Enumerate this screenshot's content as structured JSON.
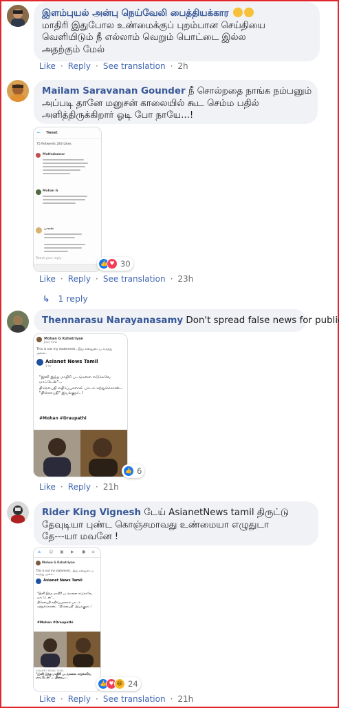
{
  "colors": {
    "link": "#385898",
    "action": "#4267b2",
    "bubble": "#f0f2f5",
    "frame": "#e0262b"
  },
  "comments": [
    {
      "author": "இளம்புயல் அன்பு நெய்வேலி பைத்தியக்கார",
      "text_lines": [
        "மாதிரி இதுபோல உண்மைக்குப் புறம்பான செய்தியை",
        "வெளியிடும் நீ எல்லாம் வெறும் பொட்டை இல்ல",
        "அதற்கும் மேல்"
      ],
      "like": "Like",
      "reply": "Reply",
      "translate": "See translation",
      "time": "2h"
    },
    {
      "author": "Mailam Saravanan Gounder",
      "text_first": "நீ சொல்றதை நாங்க நம்பனும்",
      "text_lines": [
        "அப்படி தானே மனுசன் காலையில் கூட செம்ம பதில்",
        "அளித்திருக்கிறார் ஓடி போ நாயே...!"
      ],
      "reactions": "30",
      "like": "Like",
      "reply": "Reply",
      "translate": "See translation",
      "time": "23h",
      "replies_link": "1 reply",
      "shot": {
        "header": "Tweet",
        "stats": "75 Retweets  283 Likes",
        "user1": "Muthukumar",
        "user2": "Mohan G",
        "user3": "பாலன்",
        "footer": "Tweet your reply"
      }
    },
    {
      "author": "Thennarasu Narayanasamy",
      "text_first": "Don't spread false news for publicity",
      "reactions": "6",
      "like": "Like",
      "reply": "Reply",
      "time": "21h",
      "shot": {
        "poster": "Mohan G Kshatriyan",
        "when": "Just now",
        "caption": "This is not my statement.. இது என்னுடைய கருத்து அல்ல..",
        "channel": "Asianet News Tamil",
        "ago": "1 hr",
        "quote1": "\"இனி இந்த மாதிரி படங்களை எடுக்கவே மாட்டேன்\"...",
        "quote2": "திரௌபதி எதிர்ப்புகளால் பாடம் கற்றுக்கொண்ட \"திரௌபதி\" இயக்குநர்..!",
        "tags": "#Mohan #Draupathi"
      }
    },
    {
      "author": "Rider King Vignesh",
      "text_first": "டேய் AsianetNews tamil திருட்டு",
      "text_lines": [
        "தேவுடியா புண்ட கொஞ்சமாவது உண்மையா எழுதுடா",
        "தே---யா மவனே !"
      ],
      "reactions": "24",
      "like": "Like",
      "reply": "Reply",
      "translate": "See translation",
      "time": "21h",
      "shot": {
        "poster": "Mohan G Kshatriyan",
        "caption": "This is not my statement.. இது என்னுடைய கருத்து அல்ல..",
        "channel": "Asianet News Tamil",
        "quote1": "\"இனி இந்த மாதிரி படங்களை எடுக்கவே மாட்டேன்\"...",
        "quote2": "திரௌபதி எதிர்ப்புகளால் பாடம் கற்றுக்கொண்ட \"திரௌபதி\" இயக்குநர்..!",
        "tags": "#Mohan #Draupathi",
        "source": "ASIANET NEWS TAMIL",
        "bottom": "\"இனி இந்த மாதிரி படங்களை எடுக்கவே மாட்டேன்\"... திரைப..."
      }
    }
  ]
}
